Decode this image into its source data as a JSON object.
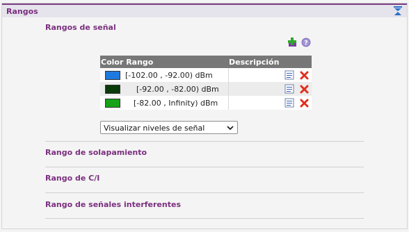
{
  "panel": {
    "title": "Rangos"
  },
  "signal_ranges": {
    "title": "Rangos de señal",
    "table": {
      "headers": {
        "color_range": "Color Rango",
        "description": "Descripción"
      },
      "rows": [
        {
          "color": "#1f7ae0",
          "range": "[-102.00 , -92.00) dBm",
          "description": ""
        },
        {
          "color": "#0a3a0a",
          "range": "[-92.00 , -82.00) dBm",
          "description": ""
        },
        {
          "color": "#17a317",
          "range": "[-82.00 , Infinity) dBm",
          "description": ""
        }
      ]
    },
    "select": {
      "value": "Visualizar niveles de señal"
    }
  },
  "sections": {
    "overlap": "Rango de solapamiento",
    "ci": "Rango de C/I",
    "interfering": "Rango de señales interferentes"
  },
  "colors": {
    "accent": "#7a2f7f",
    "header_bar": "#7d3c83",
    "delete": "#e0301e"
  },
  "icons": [
    "collapse-icon",
    "add-icon",
    "help-icon",
    "edit-icon",
    "delete-icon"
  ]
}
